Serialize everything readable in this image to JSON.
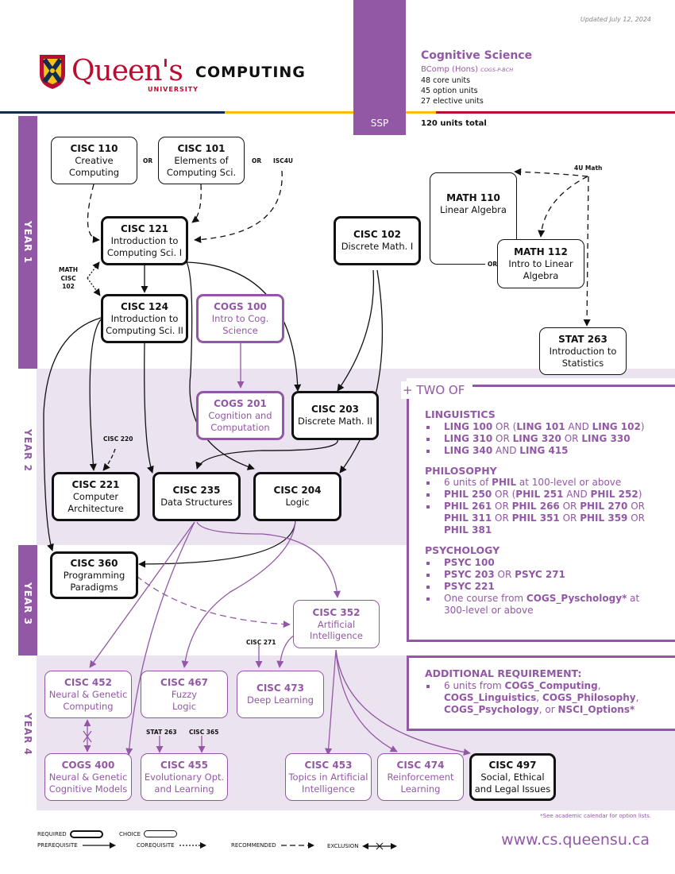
{
  "header": {
    "updated": "Updated July 12, 2024",
    "logo_text": "Queen's",
    "logo_sub": "UNIVERSITY",
    "department": "COMPUTING",
    "plan_type": "SSP",
    "program_title": "Cognitive Science",
    "degree": "BComp (Hons)",
    "plan_code": "COGS-P-BCH",
    "units": [
      "48 core units",
      "45 option units",
      "27 elective units"
    ],
    "total": "120 units total",
    "colors": {
      "purple": "#9358a5",
      "navy": "#0f2d52",
      "gold": "#fabd0f",
      "red": "#b90e31",
      "lavender": "#ece3f1"
    }
  },
  "years": [
    "YEAR 1",
    "YEAR 2",
    "YEAR 3",
    "YEAR 4"
  ],
  "courses": {
    "cisc110": {
      "code": "CISC 110",
      "title": [
        "Creative",
        "Computing"
      ]
    },
    "cisc101": {
      "code": "CISC 101",
      "title": [
        "Elements of",
        "Computing Sci."
      ]
    },
    "cisc121": {
      "code": "CISC 121",
      "title": [
        "Introduction to",
        "Computing Sci. I"
      ]
    },
    "cisc102": {
      "code": "CISC 102",
      "title": [
        "Discrete Math. I"
      ]
    },
    "math110": {
      "code": "MATH 110",
      "title": [
        "Linear Algebra"
      ]
    },
    "math112": {
      "code": "MATH 112",
      "title": [
        "Intro to Linear",
        "Algebra"
      ]
    },
    "cisc124": {
      "code": "CISC 124",
      "title": [
        "Introduction to",
        "Computing Sci. II"
      ]
    },
    "cogs100": {
      "code": "COGS 100",
      "title": [
        "Intro to Cog.",
        "Science"
      ]
    },
    "stat263": {
      "code": "STAT 263",
      "title": [
        "Introduction to",
        "Statistics"
      ]
    },
    "cogs201": {
      "code": "COGS 201",
      "title": [
        "Cognition and",
        "Computation"
      ]
    },
    "cisc203": {
      "code": "CISC 203",
      "title": [
        "Discrete Math. II"
      ]
    },
    "cisc221": {
      "code": "CISC 221",
      "title": [
        "Computer",
        "Architecture"
      ]
    },
    "cisc235": {
      "code": "CISC 235",
      "title": [
        "Data Structures"
      ]
    },
    "cisc204": {
      "code": "CISC 204",
      "title": [
        "Logic"
      ]
    },
    "cisc360": {
      "code": "CISC 360",
      "title": [
        "Programming",
        "Paradigms"
      ]
    },
    "cisc352": {
      "code": "CISC 352",
      "title": [
        "Artificial",
        "Intelligence"
      ]
    },
    "cisc452": {
      "code": "CISC 452",
      "title": [
        "Neural & Genetic",
        "Computing"
      ]
    },
    "cisc467": {
      "code": "CISC 467",
      "title": [
        "Fuzzy",
        "Logic"
      ]
    },
    "cisc473": {
      "code": "CISC 473",
      "title": [
        "Deep Learning"
      ]
    },
    "cogs400": {
      "code": "COGS 400",
      "title": [
        "Neural & Genetic",
        "Cognitive Models"
      ]
    },
    "cisc455": {
      "code": "CISC 455",
      "title": [
        "Evolutionary Opt.",
        "and Learning"
      ]
    },
    "cisc453": {
      "code": "CISC 453",
      "title": [
        "Topics in Artificial",
        "Intelligence"
      ]
    },
    "cisc474": {
      "code": "CISC 474",
      "title": [
        "Reinforcement",
        "Learning"
      ]
    },
    "cisc497": {
      "code": "CISC 497",
      "title": [
        "Social, Ethical",
        "and Legal Issues"
      ]
    }
  },
  "labels": {
    "or1": "OR",
    "or2": "OR",
    "or3": "OR",
    "isc4u": "ISC4U",
    "math_cisc_102": [
      "MATH",
      "CISC",
      "102"
    ],
    "math4u": "4U Math",
    "cisc220": "CISC 220",
    "cisc271": "CISC 271",
    "stat263_small": "STAT 263",
    "cisc365_small": "CISC 365"
  },
  "options": {
    "two_of": "+ TWO OF",
    "linguistics": {
      "heading": "LINGUISTICS",
      "items": [
        [
          [
            "LING 100",
            true
          ],
          [
            " OR (",
            false
          ],
          [
            "LING 101",
            true
          ],
          [
            " AND ",
            false
          ],
          [
            "LING 102",
            true
          ],
          [
            ")",
            false
          ]
        ],
        [
          [
            "LING 310",
            true
          ],
          [
            " OR ",
            false
          ],
          [
            "LING 320",
            true
          ],
          [
            " OR ",
            false
          ],
          [
            "LING 330",
            true
          ]
        ],
        [
          [
            "LING 340",
            true
          ],
          [
            " AND ",
            false
          ],
          [
            "LING 415",
            true
          ]
        ]
      ]
    },
    "philosophy": {
      "heading": "PHILOSOPHY",
      "items": [
        [
          [
            "6 units of ",
            false
          ],
          [
            "PHIL",
            true
          ],
          [
            " at 100-level or above",
            false
          ]
        ],
        [
          [
            "PHIL 250",
            true
          ],
          [
            " OR (",
            false
          ],
          [
            "PHIL 251",
            true
          ],
          [
            " AND ",
            false
          ],
          [
            "PHIL 252",
            true
          ],
          [
            ")",
            false
          ]
        ],
        [
          [
            "PHIL 261",
            true
          ],
          [
            " OR ",
            false
          ],
          [
            "PHIL 266",
            true
          ],
          [
            " OR ",
            false
          ],
          [
            "PHIL 270",
            true
          ],
          [
            " OR ",
            false
          ],
          [
            "PHIL 311",
            true
          ],
          [
            " OR ",
            false
          ],
          [
            "PHIL 351",
            true
          ],
          [
            " OR ",
            false
          ],
          [
            "PHIL 359",
            true
          ],
          [
            " OR ",
            false
          ],
          [
            "PHIL 381",
            true
          ]
        ]
      ]
    },
    "psychology": {
      "heading": "PSYCHOLOGY",
      "items": [
        [
          [
            "PSYC 100",
            true
          ]
        ],
        [
          [
            "PSYC 203",
            true
          ],
          [
            " OR ",
            false
          ],
          [
            "PSYC 271",
            true
          ]
        ],
        [
          [
            "PSYC 221",
            true
          ]
        ],
        [
          [
            "One course from ",
            false
          ],
          [
            "COGS_Pyschology*",
            true
          ],
          [
            " at 300-level or above",
            false
          ]
        ]
      ]
    },
    "additional": {
      "heading": "ADDITIONAL REQUIREMENT:",
      "items": [
        [
          [
            "6 units from ",
            false
          ],
          [
            "COGS_Computing",
            true
          ],
          [
            ", ",
            false
          ],
          [
            "COGS_Linguistics",
            true
          ],
          [
            ",  ",
            false
          ],
          [
            "COGS_Philosophy",
            true
          ],
          [
            ", ",
            false
          ],
          [
            "COGS_Psychology",
            true
          ],
          [
            ", or ",
            false
          ],
          [
            "NSCI_Options*",
            true
          ]
        ]
      ]
    }
  },
  "footer": {
    "footnote": "*See academic calendar for option lists.",
    "url": "www.cs.queensu.ca",
    "legend": {
      "required": "REQUIRED",
      "choice": "CHOICE",
      "prerequisite": "PREREQUISITE",
      "corequisite": "COREQUISITE",
      "recommended": "RECOMMENDED",
      "exclusion": "EXCLUSION"
    }
  }
}
